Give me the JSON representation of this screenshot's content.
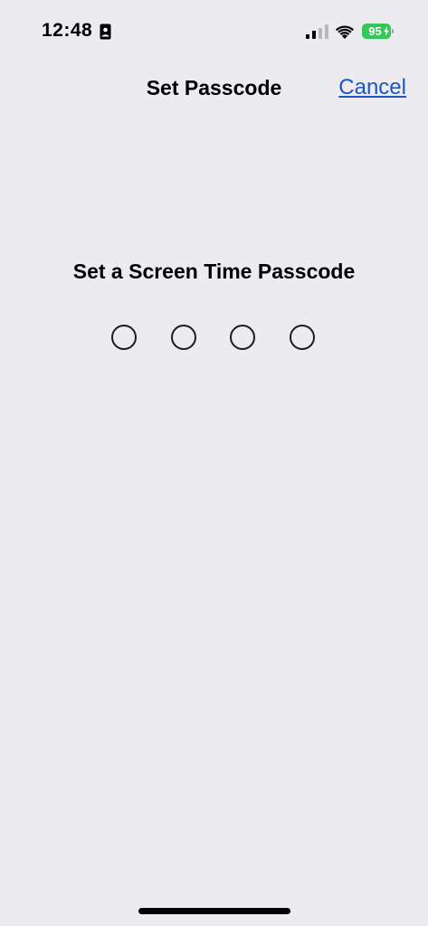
{
  "status_bar": {
    "time": "12:48",
    "battery_level": "95",
    "colors": {
      "battery": "#34c759"
    },
    "icons": [
      "focus-icon",
      "signal-icon",
      "wifi-icon",
      "battery-icon",
      "charging-bolt-icon"
    ]
  },
  "nav": {
    "title": "Set Passcode",
    "cancel_label": "Cancel"
  },
  "main": {
    "prompt": "Set a Screen Time Passcode",
    "passcode_digits_entered": 0,
    "passcode_length": 4
  },
  "colors": {
    "background": "#ececf0",
    "link": "#1a56c6"
  }
}
